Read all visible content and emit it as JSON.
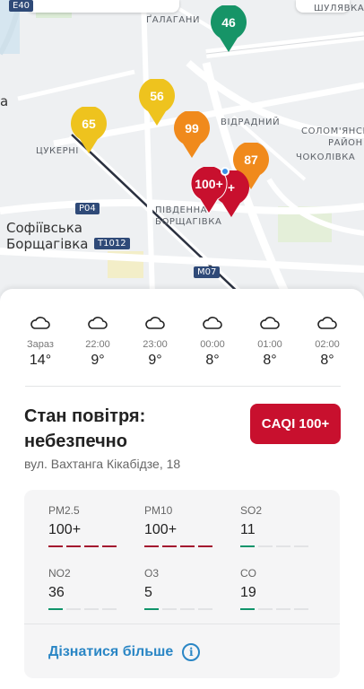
{
  "map": {
    "labels": {
      "halahany": "ҐАЛАГАНИ",
      "shuliavka": "ШУЛЯВКА",
      "vidradnyi": "ВІДРАДНИЙ",
      "solomianskyi": "СОЛОМ'ЯНСЬКИЙ",
      "raion": "РАЙОН",
      "chokolivka": "ЧОКОЛІВКА",
      "tsukerni": "ЦУКЕРНІ",
      "pivdenna": "ПІВДЕННА",
      "borshchahivka": "БОРЩАГІВКА",
      "sofiivska_1": "Софіївська",
      "sofiivska_2": "Борщагівка",
      "a_partial": "а"
    },
    "roads": {
      "e40": "E40",
      "p04": "P04",
      "t1012": "T1012",
      "m07": "M07"
    },
    "markers": [
      {
        "value": "46",
        "color": "#169467"
      },
      {
        "value": "56",
        "color": "#eec31e"
      },
      {
        "value": "65",
        "color": "#eec31e"
      },
      {
        "value": "99",
        "color": "#f08a1c"
      },
      {
        "value": "87",
        "color": "#f08a1c"
      },
      {
        "value": "100+",
        "color": "#c8102e"
      },
      {
        "value": "+",
        "color": "#c8102e"
      }
    ]
  },
  "forecast": [
    {
      "time": "Зараз",
      "temp": "14°",
      "icon": "cloud-icon"
    },
    {
      "time": "22:00",
      "temp": "9°",
      "icon": "cloud-icon"
    },
    {
      "time": "23:00",
      "temp": "9°",
      "icon": "cloud-icon"
    },
    {
      "time": "00:00",
      "temp": "8°",
      "icon": "cloud-icon"
    },
    {
      "time": "01:00",
      "temp": "8°",
      "icon": "cloud-icon"
    },
    {
      "time": "02:00",
      "temp": "8°",
      "icon": "cloud-icon"
    }
  ],
  "status": {
    "title": "Стан повітря: небезпечно",
    "address": "вул. Вахтанга Кікабідзе, 18",
    "caqi_label": "CAQI 100+",
    "caqi_color": "#c8102e"
  },
  "pollutants": [
    {
      "name": "PM2.5",
      "value": "100+",
      "level": 4
    },
    {
      "name": "PM10",
      "value": "100+",
      "level": 4
    },
    {
      "name": "SO2",
      "value": "11",
      "level": 1
    },
    {
      "name": "NO2",
      "value": "36",
      "level": 1
    },
    {
      "name": "O3",
      "value": "5",
      "level": 1
    },
    {
      "name": "CO",
      "value": "19",
      "level": 1
    }
  ],
  "more_link": "Дізнатися більше"
}
